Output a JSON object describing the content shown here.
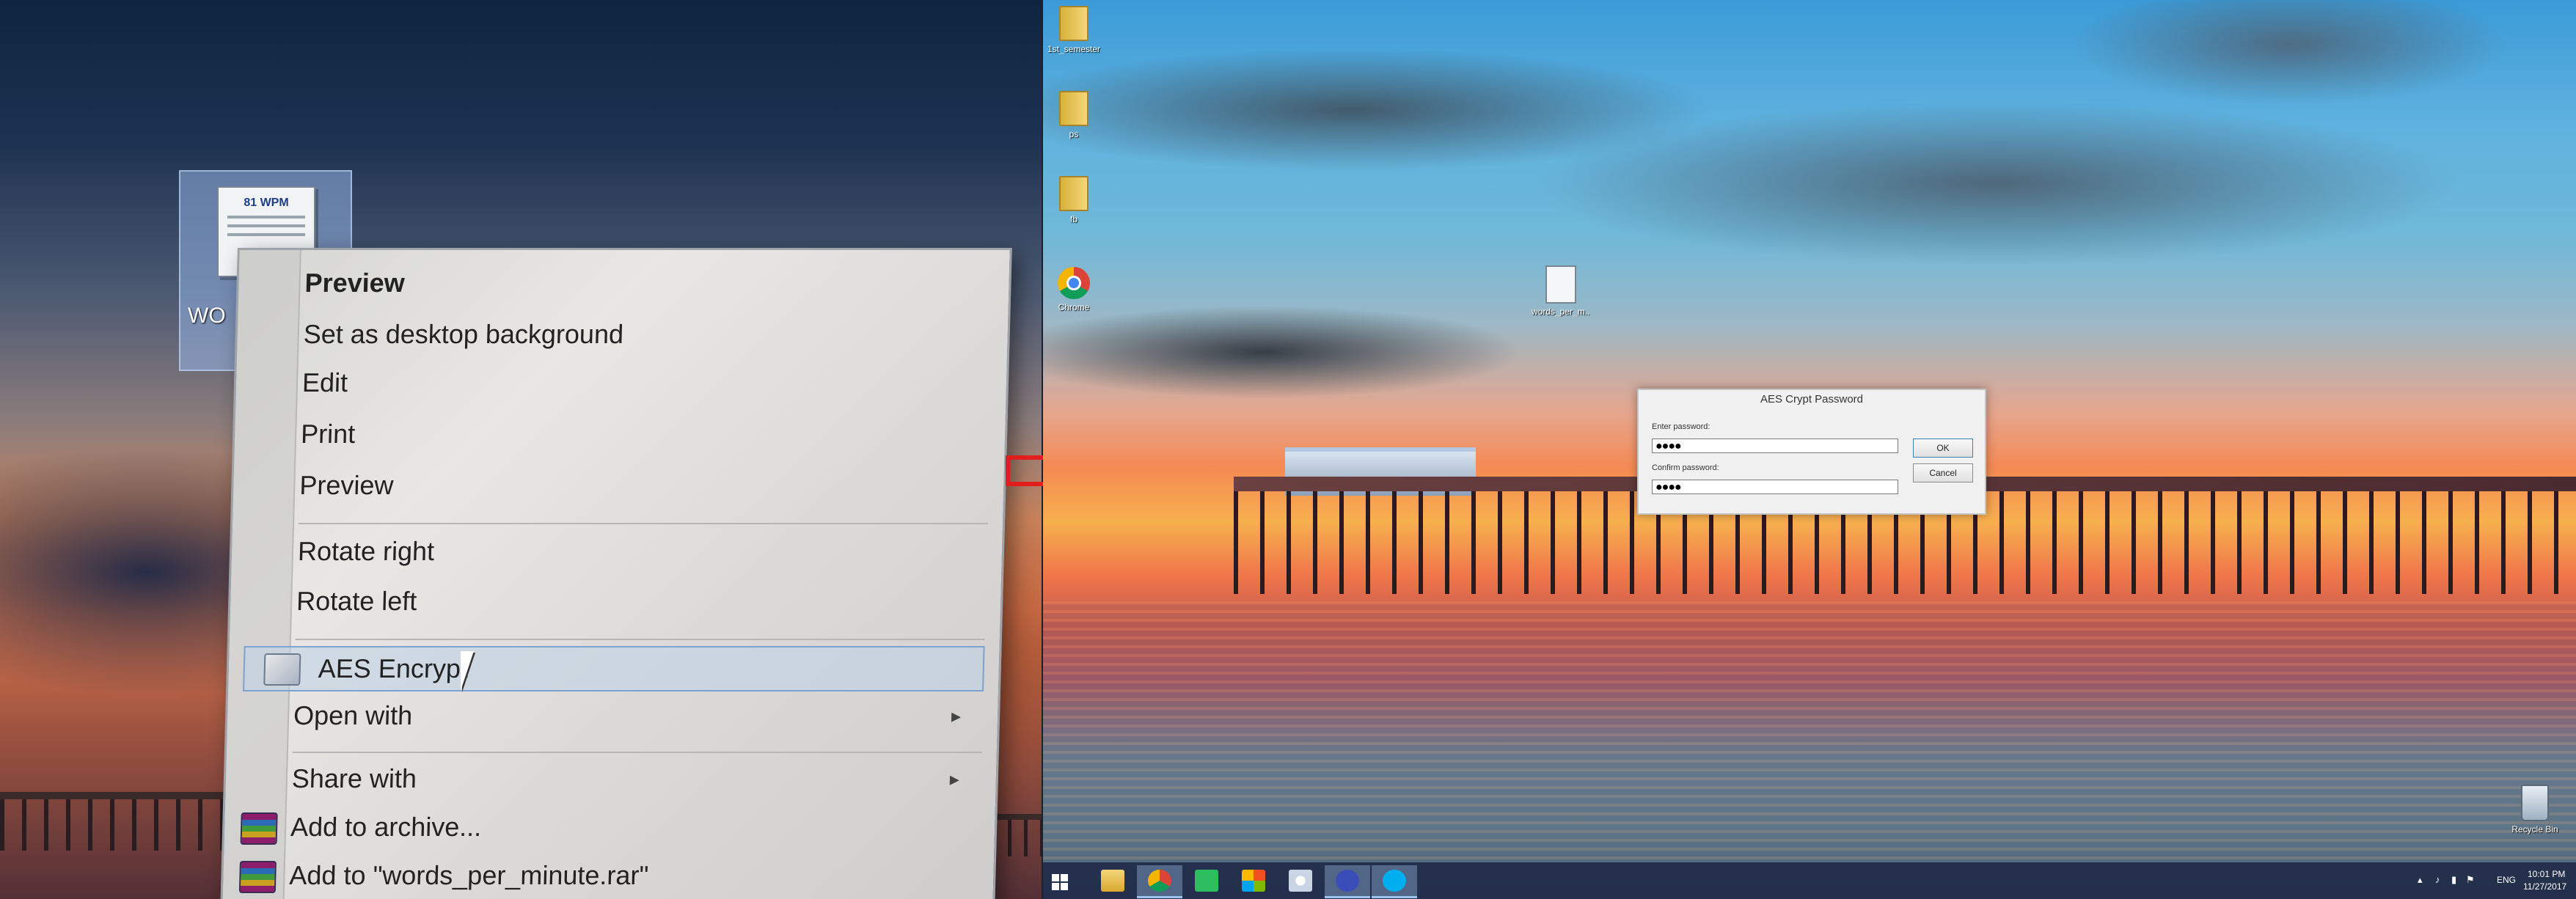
{
  "left_panel": {
    "desktop_icon_label": "WO",
    "thumbnail_title": "81 WPM",
    "context_menu": {
      "items": [
        {
          "label": "Preview",
          "bold": true
        },
        {
          "label": "Set as desktop background"
        },
        {
          "label": "Edit"
        },
        {
          "label": "Print"
        },
        {
          "label": "Preview"
        },
        {
          "label": "Rotate right"
        },
        {
          "label": "Rotate left"
        },
        {
          "label": "AES Encrypt",
          "highlighted": true,
          "icon": "aes-crypt-icon"
        },
        {
          "label": "Open with",
          "submenu": true
        },
        {
          "label": "Share with",
          "submenu": true
        },
        {
          "label": "Add to archive...",
          "icon": "winrar-icon"
        },
        {
          "label": "Add to \"words_per_minute.rar\"",
          "icon": "winrar-icon"
        }
      ],
      "submenu_glyph": "▸"
    }
  },
  "right_panel": {
    "desktop_icons": [
      {
        "label": "1st_semester",
        "icon": "folder-icon"
      },
      {
        "label": "ps",
        "icon": "folder-icon"
      },
      {
        "label": "fb",
        "icon": "folder-icon"
      },
      {
        "label": "Chrome",
        "icon": "chrome-icon"
      },
      {
        "label": "words_per_m...",
        "icon": "document-icon"
      },
      {
        "label": "Recycle Bin",
        "icon": "recycle-bin-icon"
      }
    ],
    "aes_dialog": {
      "title": "AES Crypt Password",
      "enter_label": "Enter password:",
      "enter_value": "●●●●",
      "confirm_label": "Confirm password:",
      "confirm_value": "●●●●",
      "ok_label": "OK",
      "cancel_label": "Cancel"
    },
    "taskbar": {
      "items": [
        "start-button",
        "file-explorer",
        "chrome",
        "evernote",
        "app-tiles",
        "paint",
        "settings",
        "skype"
      ],
      "tray": {
        "language": "ENG",
        "time": "10:01 PM",
        "date": "11/27/2017"
      },
      "colors": {
        "taskbar_bg": "#1e2846",
        "active_item": "#9bc4f0"
      }
    }
  },
  "arrow_color": "#e01e1e"
}
